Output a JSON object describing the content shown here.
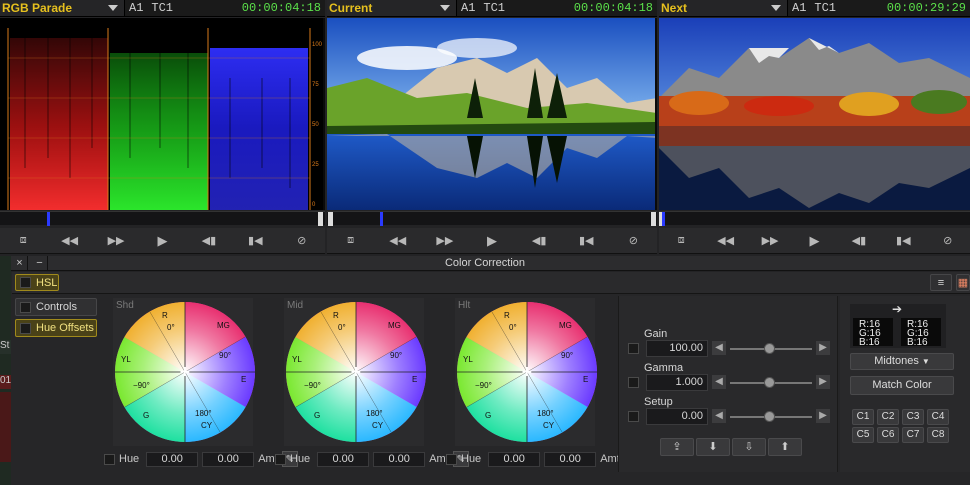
{
  "viewers": [
    {
      "name": "RGB Parade",
      "track": "A1",
      "tc_label": "TC1",
      "timecode": "00:00:04:18"
    },
    {
      "name": "Current",
      "track": "A1",
      "tc_label": "TC1",
      "timecode": "00:00:04:18"
    },
    {
      "name": "Next",
      "track": "A1",
      "tc_label": "TC1",
      "timecode": "00:00:29:29"
    }
  ],
  "parade_scale": [
    "100",
    "75",
    "50",
    "25",
    "0"
  ],
  "transport_icons": [
    "tile-icon",
    "rewind-icon",
    "fast-forward-icon",
    "play-icon",
    "prev-edit-icon",
    "next-edit-icon",
    "stop-icon"
  ],
  "panel": {
    "title": "Color Correction",
    "close": "×",
    "minimize": "−",
    "tab": "HSL",
    "options": {
      "controls": "Controls",
      "hue_offsets": "Hue Offsets"
    }
  },
  "left_strip": {
    "st": "St",
    "num": "01"
  },
  "wheels": [
    {
      "label": "Shd",
      "hue_label": "Hue",
      "hue": "0.00",
      "amt": "0.00",
      "amt_label": "Amt"
    },
    {
      "label": "Mid",
      "hue_label": "Hue",
      "hue": "0.00",
      "amt": "0.00",
      "amt_label": "Amt"
    },
    {
      "label": "Hlt",
      "hue_label": "Hue",
      "hue": "0.00",
      "amt": "0.00",
      "amt_label": "Amt"
    }
  ],
  "wheel_markings": {
    "r": "R",
    "mg": "MG",
    "yl": "YL",
    "e": "E",
    "g": "G",
    "cy": "CY",
    "deg0": "0°",
    "deg90": "90°",
    "degm90": "−90°",
    "deg180": "180°"
  },
  "sliders": [
    {
      "label": "Gain",
      "value": "100.00",
      "position": 0.5
    },
    {
      "label": "Gamma",
      "value": "1.000",
      "position": 0.5
    },
    {
      "label": "Setup",
      "value": "0.00",
      "position": 0.5
    }
  ],
  "match": {
    "source": {
      "r": "R:16",
      "g": "G:16",
      "b": "B:16"
    },
    "target": {
      "r": "R:16",
      "g": "G:16",
      "b": "B:16"
    },
    "range": "Midtones",
    "match_button": "Match Color",
    "buckets": [
      "C1",
      "C2",
      "C3",
      "C4",
      "C5",
      "C6",
      "C7",
      "C8"
    ]
  },
  "colors": {
    "accent": "#e6c01e",
    "timecode": "#5be04a",
    "playhead": "#2a3aff"
  }
}
